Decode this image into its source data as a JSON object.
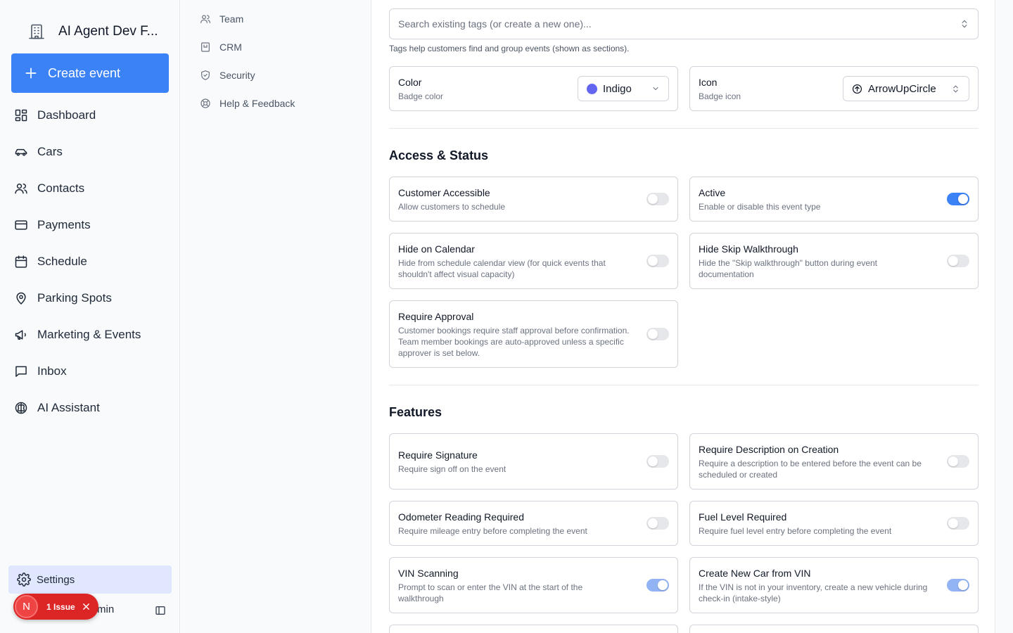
{
  "sidebar": {
    "org_name": "AI Agent Dev F...",
    "create_label": "Create event",
    "items": [
      {
        "label": "Dashboard",
        "icon": "dashboard-icon"
      },
      {
        "label": "Cars",
        "icon": "car-icon"
      },
      {
        "label": "Contacts",
        "icon": "users-icon"
      },
      {
        "label": "Payments",
        "icon": "credit-card-icon"
      },
      {
        "label": "Schedule",
        "icon": "calendar-icon"
      },
      {
        "label": "Parking Spots",
        "icon": "map-pin-icon"
      },
      {
        "label": "Marketing & Events",
        "icon": "megaphone-icon"
      },
      {
        "label": "Inbox",
        "icon": "message-square-icon"
      },
      {
        "label": "AI Assistant",
        "icon": "brain-icon"
      }
    ],
    "settings_label": "Settings",
    "user_name_partial": "min",
    "issue": {
      "avatar": "N",
      "text": "1 Issue"
    }
  },
  "subnav": {
    "items": [
      {
        "label": "Team",
        "icon": "users-icon"
      },
      {
        "label": "CRM",
        "icon": "crm-icon"
      },
      {
        "label": "Security",
        "icon": "shield-icon"
      },
      {
        "label": "Help & Feedback",
        "icon": "lifebuoy-icon"
      }
    ]
  },
  "main": {
    "tags": {
      "placeholder": "Search existing tags (or create a new one)...",
      "help": "Tags help customers find and group events (shown as sections)."
    },
    "color": {
      "title": "Color",
      "desc": "Badge color",
      "value": "Indigo",
      "swatch": "#6366f1"
    },
    "icon": {
      "title": "Icon",
      "desc": "Badge icon",
      "value": "ArrowUpCircle"
    },
    "access": {
      "title": "Access & Status",
      "customer_accessible": {
        "title": "Customer Accessible",
        "desc": "Allow customers to schedule",
        "enabled": false
      },
      "active": {
        "title": "Active",
        "desc": "Enable or disable this event type",
        "enabled": true
      },
      "hide_calendar": {
        "title": "Hide on Calendar",
        "desc": "Hide from schedule calendar view (for quick events that shouldn't affect visual capacity)",
        "enabled": false
      },
      "hide_skip": {
        "title": "Hide Skip Walkthrough",
        "desc": "Hide the \"Skip walkthrough\" button during event documentation",
        "enabled": false
      },
      "require_approval": {
        "title": "Require Approval",
        "desc": "Customer bookings require staff approval before confirmation. Team member bookings are auto-approved unless a specific approver is set below.",
        "enabled": false
      }
    },
    "features": {
      "title": "Features",
      "signature": {
        "title": "Require Signature",
        "desc": "Require sign off on the event",
        "enabled": false
      },
      "description": {
        "title": "Require Description on Creation",
        "desc": "Require a description to be entered before the event can be scheduled or created",
        "enabled": false
      },
      "odometer": {
        "title": "Odometer Reading Required",
        "desc": "Require mileage entry before completing the event",
        "enabled": false
      },
      "fuel": {
        "title": "Fuel Level Required",
        "desc": "Require fuel level entry before completing the event",
        "enabled": false
      },
      "vin": {
        "title": "VIN Scanning",
        "desc": "Prompt to scan or enter the VIN at the start of the walkthrough",
        "enabled": true
      },
      "create_car": {
        "title": "Create New Car from VIN",
        "desc": "If the VIN is not in your inventory, create a new vehicle during check-in (intake-style)",
        "enabled": true
      }
    }
  }
}
